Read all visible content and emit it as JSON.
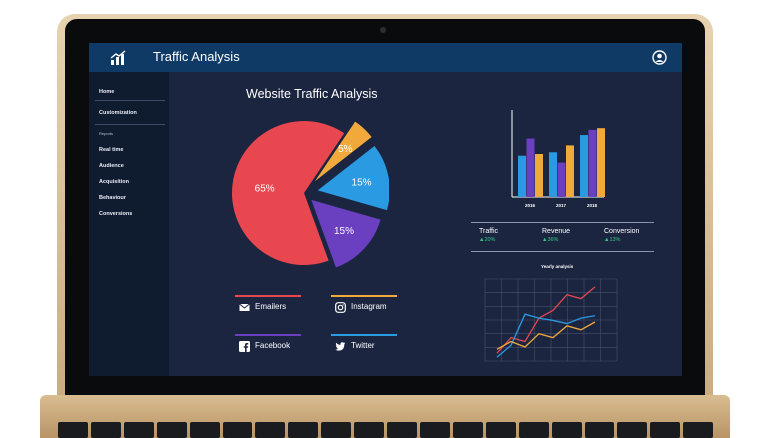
{
  "app": {
    "title": "Traffic Analysis"
  },
  "sidebar": {
    "items": [
      {
        "label": "Home"
      },
      {
        "label": "Customization"
      }
    ],
    "reports_label": "Reports",
    "reports_items": [
      {
        "label": "Real time"
      },
      {
        "label": "Audience"
      },
      {
        "label": "Acquisition"
      },
      {
        "label": "Behaviour"
      },
      {
        "label": "Conversions"
      }
    ]
  },
  "pie": {
    "title": "Website Traffic Analysis",
    "slices": [
      {
        "label": "65%",
        "value": 65,
        "color": "#e8474f"
      },
      {
        "label": "5%",
        "value": 5,
        "color": "#f2a93b"
      },
      {
        "label": "15%",
        "value": 15,
        "color": "#2a9be3"
      },
      {
        "label": "15%",
        "value": 15,
        "color": "#6a3fc0"
      }
    ]
  },
  "legend": [
    {
      "label": "Emailers",
      "color": "#e8474f",
      "icon": "mail-icon"
    },
    {
      "label": "Instagram",
      "color": "#f2a93b",
      "icon": "instagram-icon"
    },
    {
      "label": "Facebook",
      "color": "#6a3fc0",
      "icon": "facebook-icon"
    },
    {
      "label": "Twitter",
      "color": "#2a9be3",
      "icon": "twitter-icon"
    }
  ],
  "chart_data": [
    {
      "type": "bar",
      "categories": [
        "2016",
        "2017",
        "2018"
      ],
      "series": [
        {
          "values": [
            48,
            52,
            72
          ],
          "color": "#2a9be3"
        },
        {
          "values": [
            68,
            40,
            78
          ],
          "color": "#6a3fc0"
        },
        {
          "values": [
            50,
            60,
            80
          ],
          "color": "#f2a93b"
        }
      ],
      "ylim": [
        0,
        100
      ]
    },
    {
      "type": "line",
      "title": "Yearly analysis",
      "x": [
        0,
        1,
        2,
        3,
        4,
        5,
        6,
        7,
        8
      ],
      "series": [
        {
          "color": "#e8474f",
          "values": [
            10,
            30,
            25,
            55,
            65,
            85,
            80,
            95,
            null
          ]
        },
        {
          "color": "#2a9be3",
          "values": [
            5,
            20,
            60,
            55,
            52,
            48,
            55,
            58,
            null
          ]
        },
        {
          "color": "#f2a93b",
          "values": [
            15,
            25,
            18,
            35,
            30,
            45,
            40,
            50,
            null
          ]
        }
      ],
      "grid": true
    }
  ],
  "stats": [
    {
      "label": "Traffic",
      "value": "▲20%"
    },
    {
      "label": "Revenue",
      "value": "▲36%"
    },
    {
      "label": "Conversion",
      "value": "▲13%"
    }
  ]
}
